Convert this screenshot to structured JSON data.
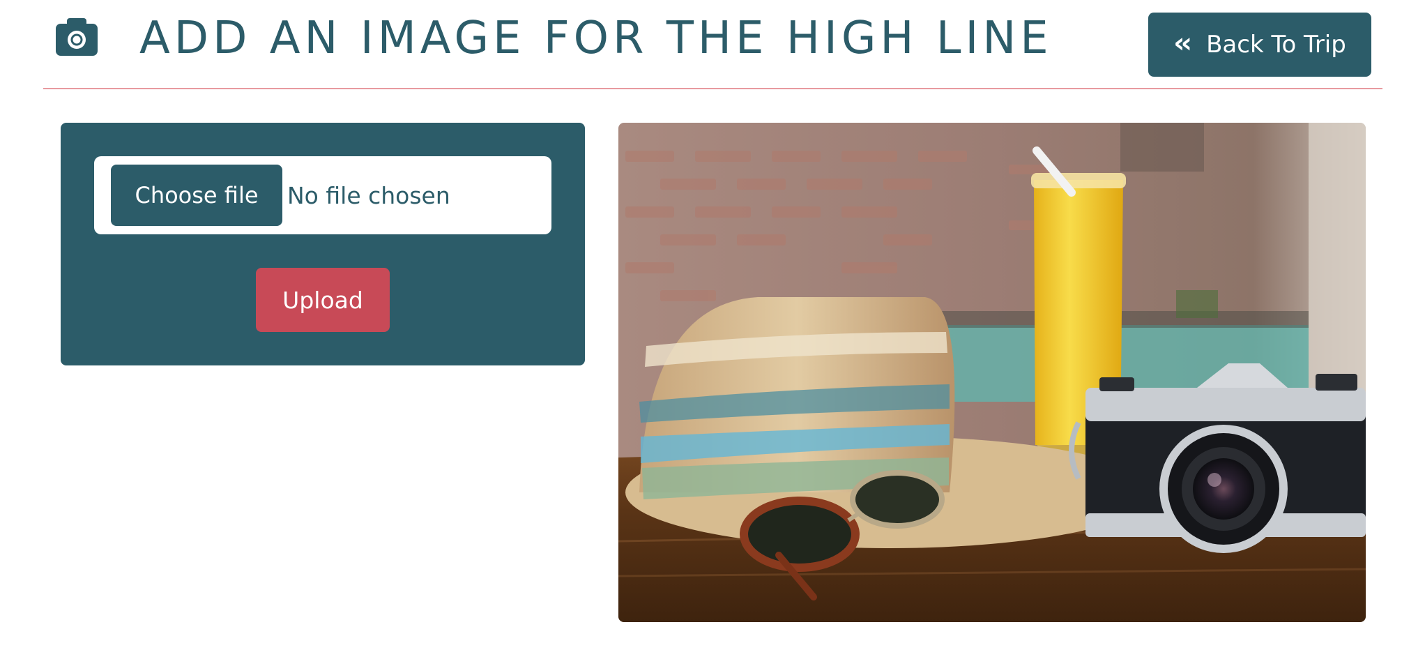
{
  "header": {
    "icon": "camera-icon",
    "title": "ADD AN IMAGE FOR THE HIGH LINE",
    "back_button": {
      "icon": "double-chevron-left-icon",
      "label": "Back To Trip"
    }
  },
  "upload_form": {
    "choose_button_label": "Choose file",
    "file_status": "No file chosen",
    "upload_button_label": "Upload"
  },
  "colors": {
    "primary": "#2c5c69",
    "accent": "#c84a57",
    "divider": "#e89a9f",
    "background": "#ffffff"
  }
}
